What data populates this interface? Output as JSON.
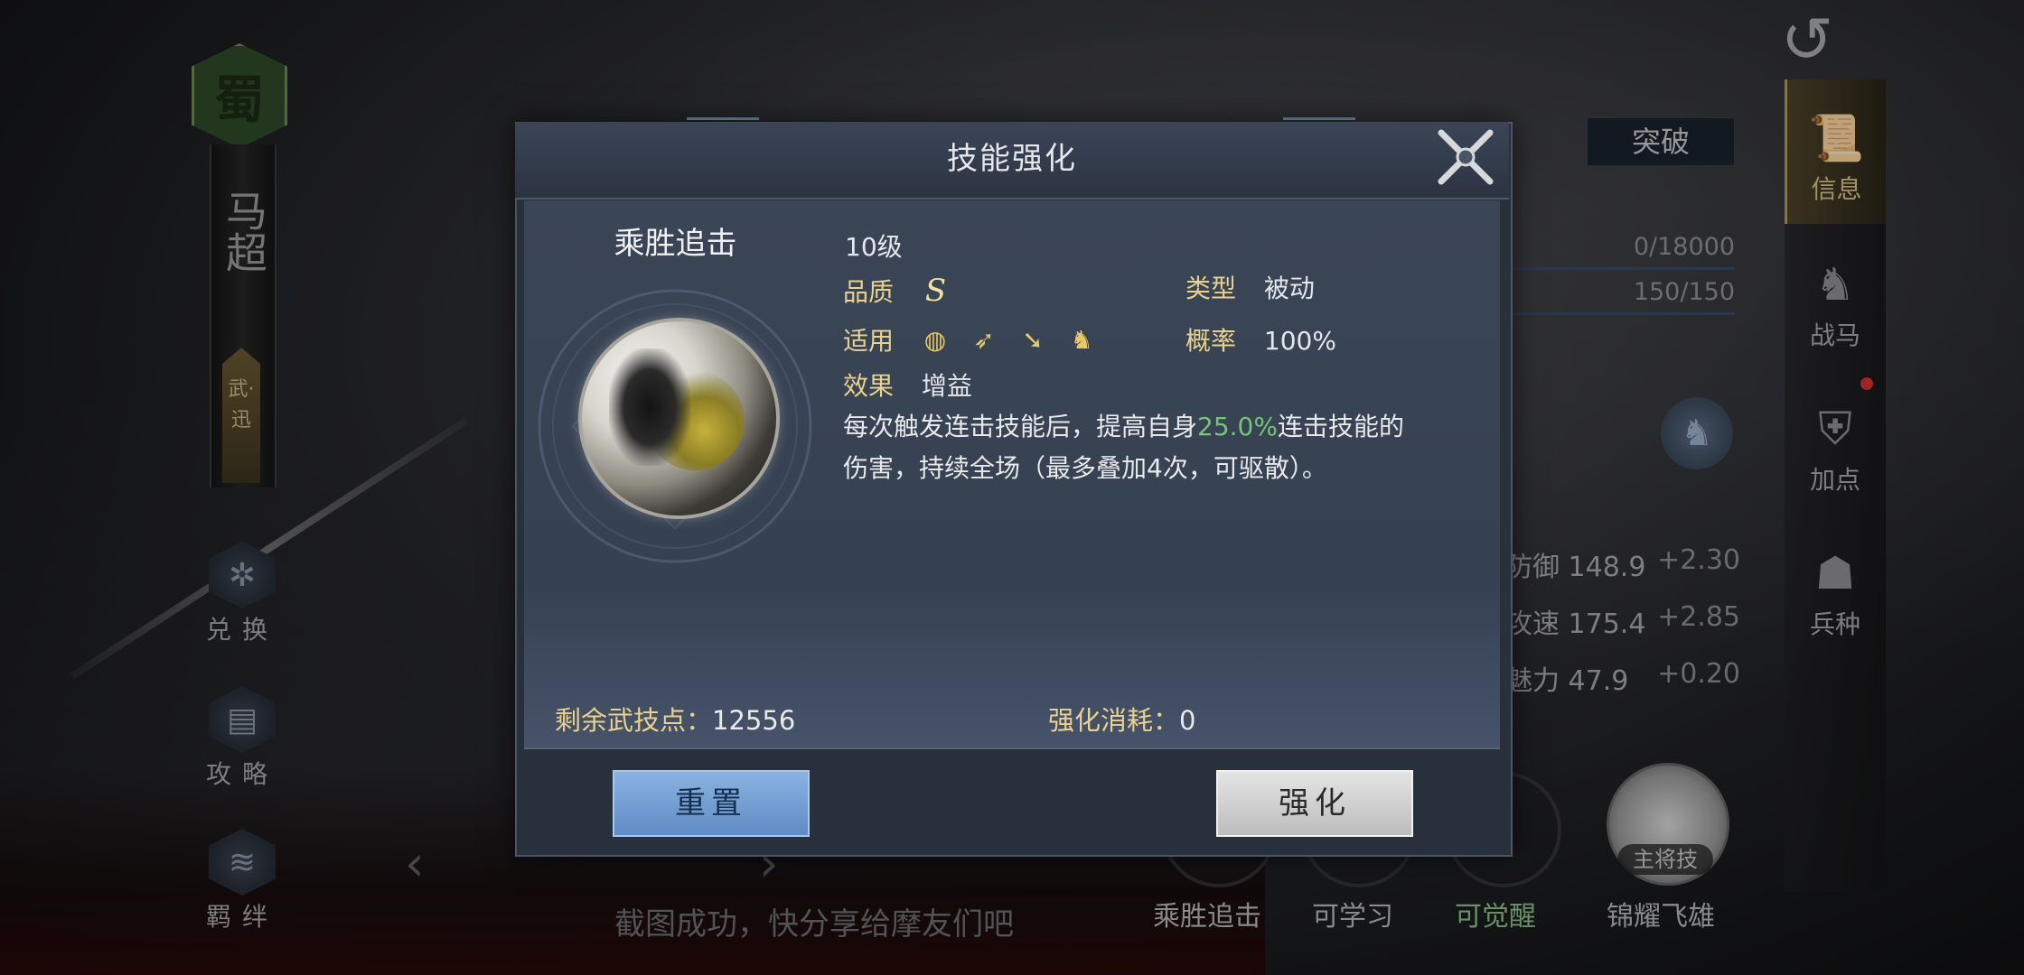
{
  "hero": {
    "faction": "蜀",
    "name": "马超",
    "tag": "武·迅"
  },
  "side_menu": [
    {
      "label": "兑换",
      "icon": "exchange-icon"
    },
    {
      "label": "攻略",
      "icon": "scroll-icon"
    },
    {
      "label": "羁绊",
      "icon": "bond-icon"
    }
  ],
  "right_tabs": [
    {
      "label": "信息",
      "icon": "scroll-icon",
      "active": true
    },
    {
      "label": "战马",
      "icon": "horse-icon",
      "active": false
    },
    {
      "label": "加点",
      "icon": "armor-icon",
      "active": false
    },
    {
      "label": "兵种",
      "icon": "soldier-icon",
      "active": false
    }
  ],
  "background_panel": {
    "breakthrough_label": "突破",
    "exp": "0/18000",
    "stamina": "150/150",
    "stats": [
      {
        "label": "防御",
        "value": "148.9",
        "bonus": "+2.30"
      },
      {
        "label": "攻速",
        "value": "175.4",
        "bonus": "+2.85"
      },
      {
        "label": "魅力",
        "value": "47.9",
        "bonus": "+0.20"
      }
    ],
    "skills": [
      {
        "label": "乘胜追击",
        "badge": "10级",
        "style": "normal"
      },
      {
        "label": "可学习",
        "style": "normal"
      },
      {
        "label": "可觉醒",
        "style": "green"
      },
      {
        "label": "锦耀飞雄",
        "badge": "主将技",
        "style": "normal"
      }
    ],
    "toast": "截图成功，快分享给摩友们吧"
  },
  "dialog": {
    "title": "技能强化",
    "skill_name": "乘胜追击",
    "level": "10级",
    "quality_label": "品质",
    "quality_value": "S",
    "type_label": "类型",
    "type_value": "被动",
    "applies_label": "适用",
    "applies_icons": [
      "shield-icon",
      "bow-icon",
      "spear-icon",
      "horse-icon"
    ],
    "chance_label": "概率",
    "chance_value": "100%",
    "effect_label": "效果",
    "effect_value": "增益",
    "desc_part1": "每次触发连击技能后，提高自身",
    "desc_highlight": "25.0%",
    "desc_part2": "连击技能的",
    "desc_line2": "伤害，持续全场（最多叠加4次，可驱散）。",
    "points_label": "剩余武技点：",
    "points_value": "12556",
    "cost_label": "强化消耗：",
    "cost_value": "0",
    "reset_label": "重置",
    "enhance_label": "强化"
  },
  "colors": {
    "accent_gold": "#e9d28f",
    "highlight_green": "#76c47a",
    "reset_blue": "#6f9bd3",
    "dialog_bg": "#28303c"
  }
}
